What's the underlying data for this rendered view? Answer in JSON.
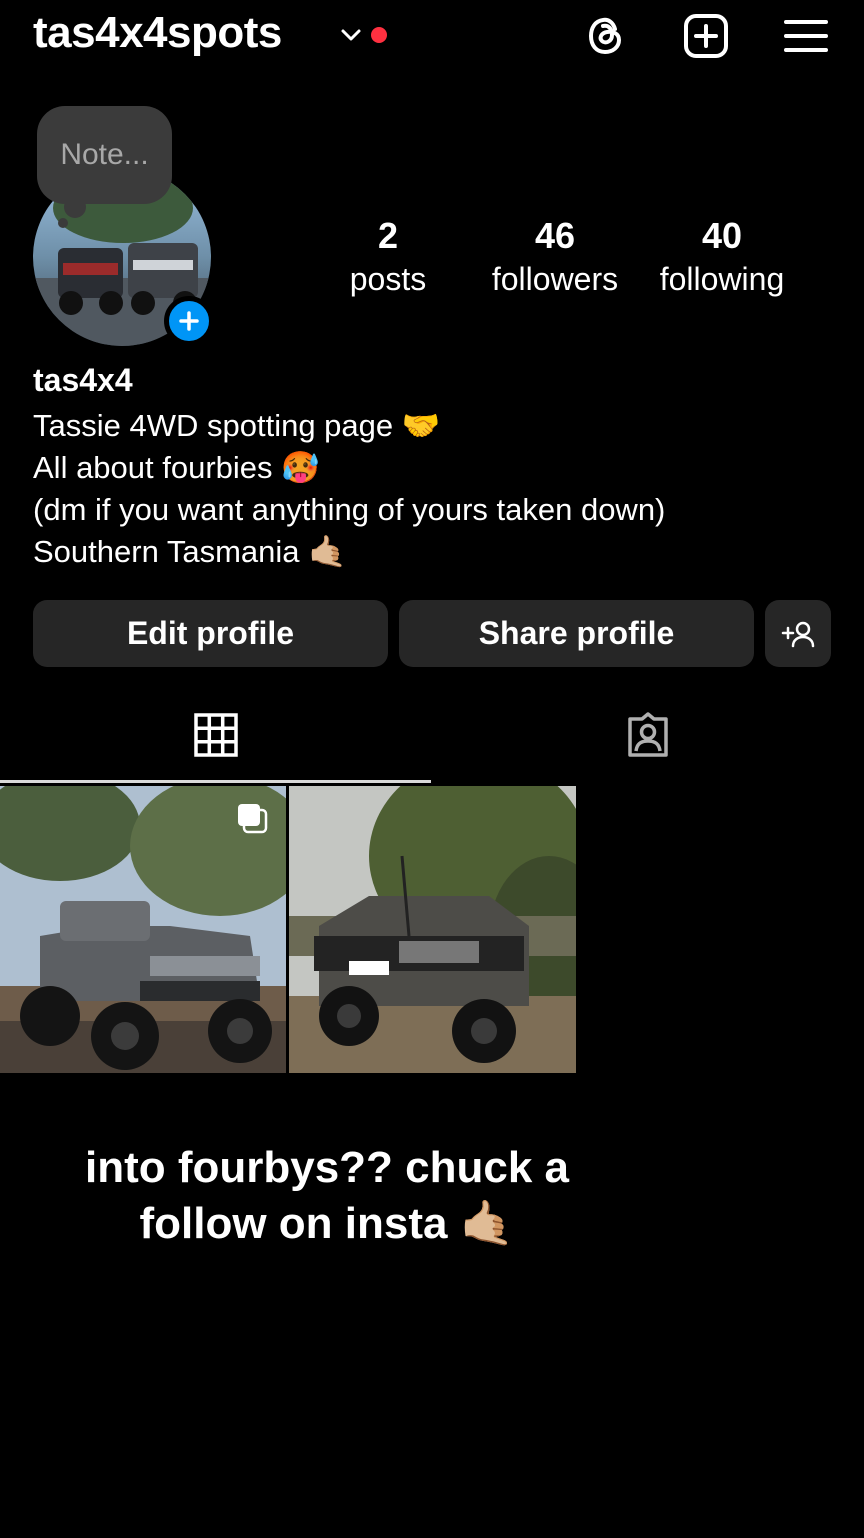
{
  "header": {
    "username": "tas4x4spots",
    "icons": [
      "chevron-down-icon",
      "notification-dot",
      "threads-icon",
      "add-post-icon",
      "menu-icon"
    ]
  },
  "note": {
    "placeholder": "Note..."
  },
  "stats": [
    {
      "value": "2",
      "label": "posts"
    },
    {
      "value": "46",
      "label": "followers"
    },
    {
      "value": "40",
      "label": "following"
    }
  ],
  "profile": {
    "name": "tas4x4",
    "bio": [
      "Tassie 4WD spotting page 🤝",
      "All about fourbies 🥵",
      "(dm if you want anything of yours taken down)",
      "Southern Tasmania 🤙🏼"
    ]
  },
  "buttons": {
    "edit": "Edit profile",
    "share": "Share profile"
  },
  "tabs": [
    "grid-tab",
    "tagged-tab"
  ],
  "caption": {
    "line1": "into fourbys?? chuck a",
    "line2": "follow on insta 🤙🏼"
  },
  "colors": {
    "background": "#000000",
    "button": "#262626",
    "accent": "#0095f6",
    "notification": "#ff3040"
  }
}
